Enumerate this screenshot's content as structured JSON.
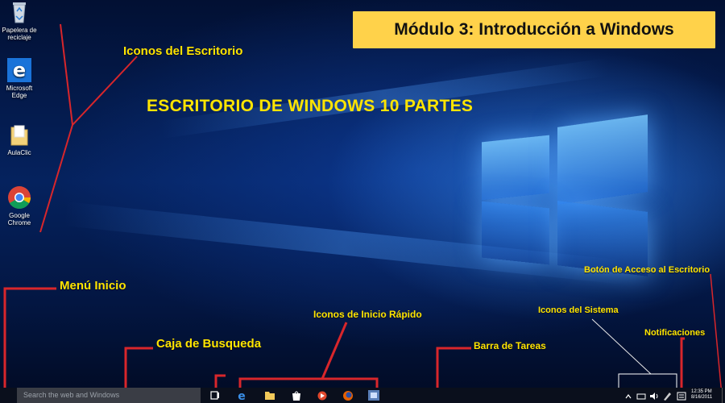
{
  "header": {
    "module_title": "Módulo 3: Introducción a Windows",
    "main_heading": "ESCRITORIO DE WINDOWS 10  PARTES"
  },
  "desktop_icons": [
    {
      "label": "Papelera de reciclaje",
      "icon": "recycle-bin-icon"
    },
    {
      "label": "Microsoft Edge",
      "icon": "edge-icon"
    },
    {
      "label": "AulaClic",
      "icon": "folder-icon"
    },
    {
      "label": "Google Chrome",
      "icon": "chrome-icon"
    }
  ],
  "annotations": {
    "iconos_escritorio": "Iconos del Escritorio",
    "menu_inicio": "Menú Inicio",
    "caja_busqueda": "Caja de Busqueda",
    "inicio_rapido": "Iconos de Inicio Rápido",
    "barra_tareas": "Barra de Tareas",
    "iconos_sistema": "Iconos del Sistema",
    "notificaciones": "Notificaciones",
    "boton_escritorio": "Botón de Acceso al Escritorio"
  },
  "taskbar": {
    "search_placeholder": "Search the web and Windows",
    "pinned_icons": [
      "task-view-icon",
      "edge-icon",
      "file-explorer-icon",
      "store-icon",
      "media-app-icon",
      "firefox-icon",
      "windows-media-icon"
    ],
    "tray_icons": [
      "chevron-up-icon",
      "network-icon",
      "volume-icon",
      "pen-icon",
      "notification-center-icon"
    ],
    "clock_time": "12:35 PM",
    "clock_date": "8/16/2011"
  },
  "colors": {
    "label_yellow": "#ffe400",
    "title_box": "#ffd24a",
    "pointer_red": "#d8262b"
  }
}
